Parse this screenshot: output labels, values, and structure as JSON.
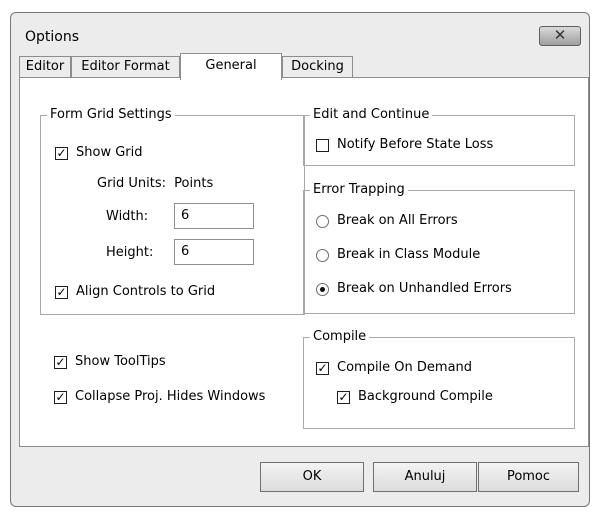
{
  "window": {
    "title": "Options",
    "close_glyph": "✕"
  },
  "tabs": [
    {
      "label": "Editor"
    },
    {
      "label": "Editor Format"
    },
    {
      "label": "General",
      "active": true
    },
    {
      "label": "Docking"
    }
  ],
  "form_grid": {
    "legend": "Form Grid Settings",
    "show_grid": {
      "label": "Show Grid",
      "checked": true
    },
    "grid_units_label": "Grid Units:",
    "grid_units_value": "Points",
    "width_label": "Width:",
    "width_value": "6",
    "height_label": "Height:",
    "height_value": "6",
    "align_controls": {
      "label": "Align Controls to Grid",
      "checked": true
    }
  },
  "show_tooltips": {
    "label": "Show ToolTips",
    "checked": true
  },
  "collapse_proj": {
    "label": "Collapse Proj. Hides Windows",
    "checked": true
  },
  "edit_continue": {
    "legend": "Edit and Continue",
    "notify": {
      "label": "Notify Before State Loss",
      "checked": false
    }
  },
  "error_trapping": {
    "legend": "Error Trapping",
    "options": [
      {
        "label": "Break on All Errors",
        "selected": false
      },
      {
        "label": "Break in Class Module",
        "selected": false
      },
      {
        "label": "Break on Unhandled Errors",
        "selected": true
      }
    ]
  },
  "compile": {
    "legend": "Compile",
    "on_demand": {
      "label": "Compile On Demand",
      "checked": true
    },
    "background": {
      "label": "Background Compile",
      "checked": true
    }
  },
  "buttons": {
    "ok": "OK",
    "cancel": "Anuluj",
    "help": "Pomoc"
  },
  "check_glyph": "✓"
}
